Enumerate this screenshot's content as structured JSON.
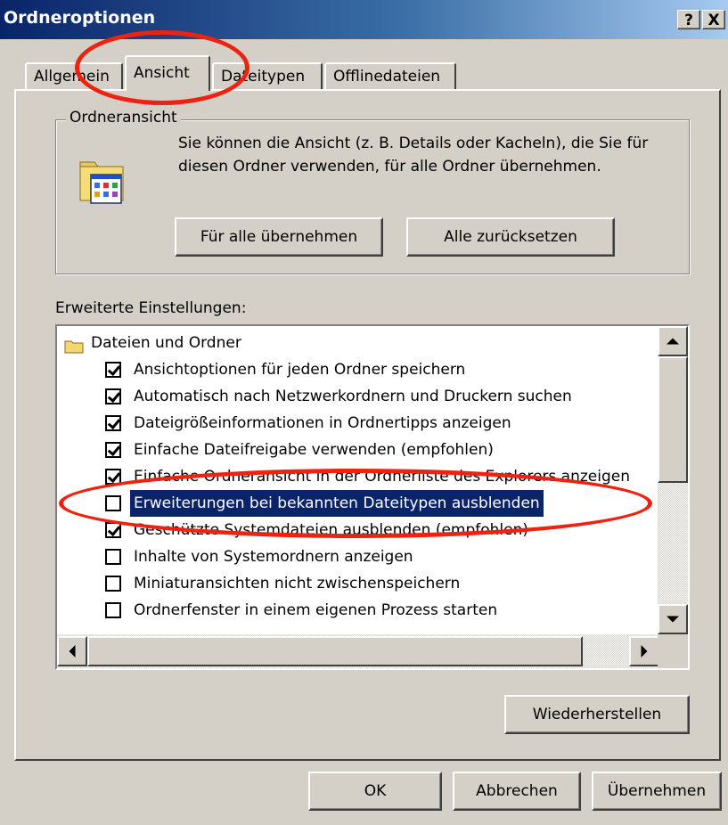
{
  "window": {
    "title": "Ordneroptionen",
    "help_label": "?",
    "close_label": "X"
  },
  "tabs": [
    {
      "label": "Allgemein"
    },
    {
      "label": "Ansicht",
      "active": true
    },
    {
      "label": "Dateitypen"
    },
    {
      "label": "Offlinedateien"
    }
  ],
  "folder_view": {
    "legend": "Ordneransicht",
    "description": "Sie können die Ansicht (z. B. Details oder Kacheln), die Sie für diesen Ordner verwenden, für alle Ordner übernehmen.",
    "apply_all_label": "Für alle übernehmen",
    "reset_all_label": "Alle zurücksetzen"
  },
  "advanced": {
    "label": "Erweiterte Einstellungen:",
    "root": "Dateien und Ordner",
    "items": [
      {
        "label": "Ansichtoptionen für jeden Ordner speichern",
        "checked": true
      },
      {
        "label": "Automatisch nach Netzwerkordnern und Druckern suchen",
        "checked": true
      },
      {
        "label": "Dateigrößeinformationen in Ordnertipps anzeigen",
        "checked": true
      },
      {
        "label": "Einfache Dateifreigabe verwenden (empfohlen)",
        "checked": true
      },
      {
        "label": "Einfache Ordneransicht in der Ordnerliste des Explorers anzeigen",
        "checked": true
      },
      {
        "label": "Erweiterungen bei bekannten Dateitypen ausblenden",
        "checked": false,
        "selected": true
      },
      {
        "label": "Geschützte Systemdateien ausblenden (empfohlen)",
        "checked": true
      },
      {
        "label": "Inhalte von Systemordnern anzeigen",
        "checked": false
      },
      {
        "label": "Miniaturansichten nicht zwischenspeichern",
        "checked": false
      },
      {
        "label": "Ordnerfenster in einem eigenen Prozess starten",
        "checked": false
      }
    ],
    "restore_label": "Wiederherstellen"
  },
  "footer": {
    "ok_label": "OK",
    "cancel_label": "Abbrechen",
    "apply_label": "Übernehmen"
  },
  "colors": {
    "annotation": "#ee2211",
    "selection": "#0a246a"
  }
}
